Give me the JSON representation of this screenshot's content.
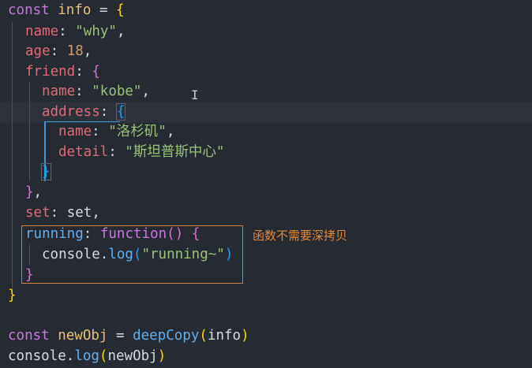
{
  "code": {
    "kw_const": "const",
    "info": "info",
    "eq": "=",
    "brace_open": "{",
    "brace_close": "}",
    "brace_close_comma": "},",
    "name_key": "name",
    "age_key": "age",
    "friend_key": "friend",
    "address_key": "address",
    "detail_key": "detail",
    "set_key": "set",
    "running_key": "running",
    "colon": ":",
    "comma": ",",
    "why": "\"why\"",
    "age_val": "18",
    "kobe": "\"kobe\"",
    "la": "\"洛杉矶\"",
    "detail_val": "\"斯坦普斯中心\"",
    "set_val": "set",
    "function_kw": "function",
    "parens": "()",
    "console": "console",
    "dot": ".",
    "log": "log",
    "paren_open": "(",
    "paren_close": ")",
    "running_str": "\"running~\"",
    "newObj": "newObj",
    "deepCopy": "deepCopy"
  },
  "annotation": {
    "text": "函数不需要深拷贝",
    "color": "#e0883c"
  },
  "cursor_glyph": "I"
}
